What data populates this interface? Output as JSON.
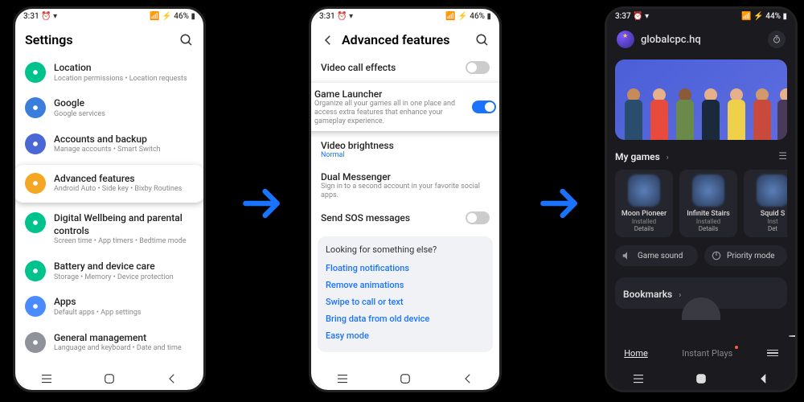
{
  "phone1": {
    "time": "3:31",
    "battery": "46%",
    "title": "Settings",
    "items": [
      {
        "icon_color": "#00c28c",
        "title": "Location",
        "sub": "Location permissions  •  Location requests"
      },
      {
        "icon_color": "#3b7ddd",
        "title": "Google",
        "sub": "Google services"
      },
      {
        "icon_color": "#4a67d6",
        "title": "Accounts and backup",
        "sub": "Manage accounts  •  Smart Switch"
      },
      {
        "icon_color": "#f5a623",
        "title": "Advanced features",
        "sub": "Android Auto  •  Side key  •  Bixby Routines",
        "highlight": true
      },
      {
        "icon_color": "#00c28c",
        "title": "Digital Wellbeing and parental controls",
        "sub": "Screen time  •  App timers  •  Bedtime mode"
      },
      {
        "icon_color": "#00c28c",
        "title": "Battery and device care",
        "sub": "Storage  •  Memory  •  Device protection"
      },
      {
        "icon_color": "#4a8cff",
        "title": "Apps",
        "sub": "Default apps  •  App settings"
      },
      {
        "icon_color": "#8e9299",
        "title": "General management",
        "sub": "Language and keyboard  •  Date and time"
      }
    ]
  },
  "phone2": {
    "time": "3:31",
    "battery": "46%",
    "title": "Advanced features",
    "rows": [
      {
        "title": "Video call effects",
        "toggle": true,
        "on": false
      },
      {
        "title": "Game Launcher",
        "sub": "Organize all your games all in one place and access extra features that enhance your gameplay experience.",
        "toggle": true,
        "on": true,
        "highlight": true
      },
      {
        "title": "Video brightness",
        "value": "Normal"
      },
      {
        "title": "Dual Messenger",
        "sub": "Sign in to a second account in your favorite social apps."
      },
      {
        "title": "Send SOS messages",
        "toggle": true,
        "on": false
      }
    ],
    "extra_title": "Looking for something else?",
    "extras": [
      "Floating notifications",
      "Remove animations",
      "Swipe to call or text",
      "Bring data from old device",
      "Easy mode"
    ]
  },
  "phone3": {
    "time": "3:37",
    "battery": "44%",
    "username": "globalcpc.hq",
    "my_games": "My games",
    "games": [
      {
        "name": "Moon Pioneer",
        "status": "Installed",
        "details": "Details"
      },
      {
        "name": "Infinite Stairs",
        "status": "Installed",
        "details": "Details"
      },
      {
        "name": "Squid S",
        "status": "Inst",
        "details": "Det"
      }
    ],
    "sound": "Game sound",
    "priority": "Priority mode",
    "bookmarks": "Bookmarks",
    "tabs": [
      "Home",
      "Instant Plays"
    ]
  }
}
